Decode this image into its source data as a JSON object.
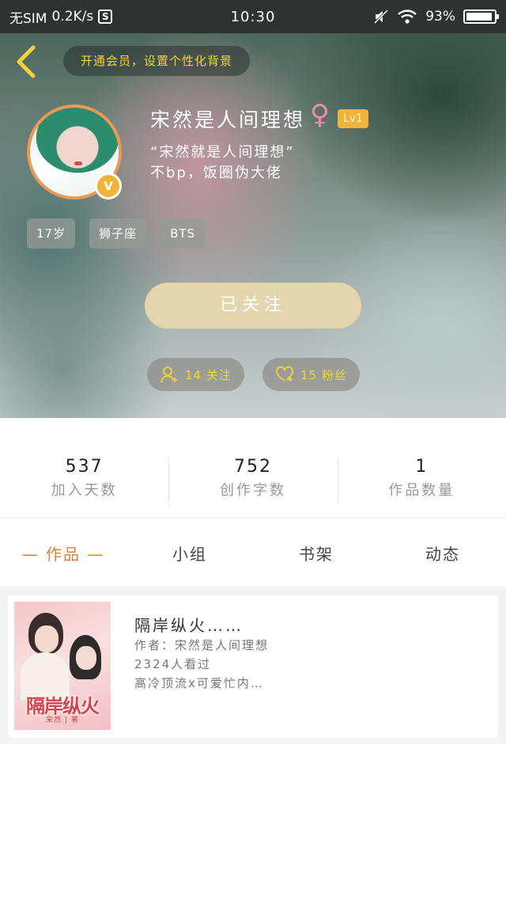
{
  "status_bar": {
    "carrier": "无SIM",
    "speed": "0.2K/s",
    "s_icon": "S",
    "time": "10:30",
    "battery": "93%",
    "battery_fraction": 0.93
  },
  "header": {
    "vip_prompt": "开通会员，设置个性化背景",
    "nickname": "宋然是人间理想",
    "gender_symbol": "♀",
    "level": "Lv1",
    "badge_letter": "V",
    "signature_line1": "“宋然就是人间理想”",
    "signature_line2": "不bp，饭圈伪大佬",
    "tags": [
      "17岁",
      "狮子座",
      "BTS"
    ],
    "follow_label": "已关注",
    "following": "14 关注",
    "fans": "15 粉丝",
    "accent": "#f5d33a"
  },
  "stats": [
    {
      "num": "537",
      "label": "加入天数"
    },
    {
      "num": "752",
      "label": "创作字数"
    },
    {
      "num": "1",
      "label": "作品数量"
    }
  ],
  "tabs": [
    {
      "label": "— 作品 —"
    },
    {
      "label": "小组"
    },
    {
      "label": "书架"
    },
    {
      "label": "动态"
    }
  ],
  "work": {
    "title": "隔岸纵火……",
    "author": "作者：宋然是人间理想",
    "views": "2324人看过",
    "desc": "高冷顶流x可爱忙内…",
    "cover_title": "隔岸纵火",
    "cover_subtitle": "宋然 | 著"
  }
}
